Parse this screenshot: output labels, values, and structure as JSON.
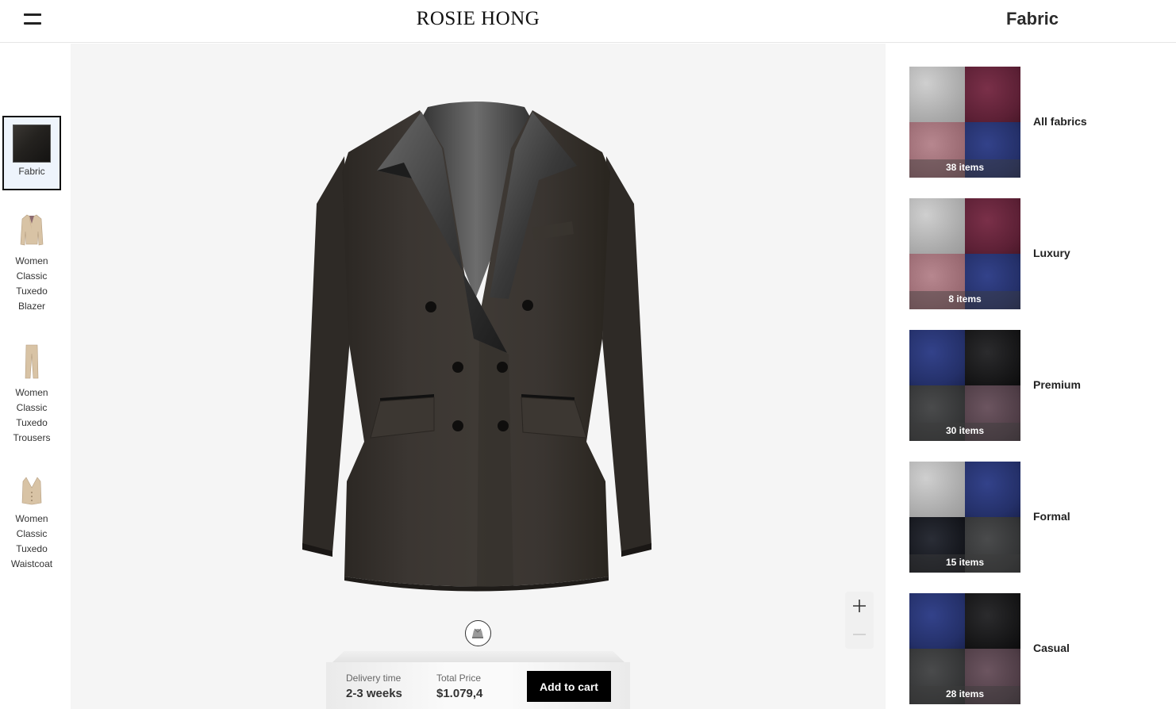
{
  "header": {
    "brand": "ROSIE HONG",
    "panel_title": "Fabric"
  },
  "left_rail": {
    "items": [
      {
        "label": "Fabric",
        "icon": "fabric-swatch-icon",
        "selected": true
      },
      {
        "label": "Women Classic Tuxedo Blazer",
        "icon": "blazer-icon",
        "selected": false
      },
      {
        "label": "Women Classic Tuxedo Trousers",
        "icon": "trousers-icon",
        "selected": false
      },
      {
        "label": "Women Classic Tuxedo Waistcoat",
        "icon": "waistcoat-icon",
        "selected": false
      }
    ]
  },
  "viewer": {
    "product_icon": "double-breasted-tuxedo-blazer",
    "view_toggle_icon": "model-view-icon",
    "zoom_in_icon": "plus-icon",
    "zoom_out_icon": "minus-icon"
  },
  "order_bar": {
    "delivery_label": "Delivery time",
    "delivery_value": "2-3 weeks",
    "price_label": "Total Price",
    "price_value": "$1.079,4",
    "cart_button": "Add to cart"
  },
  "fabric_categories": [
    {
      "name": "All fabrics",
      "count": "38 items",
      "swatches": [
        "grey",
        "burgundy",
        "rose",
        "navy"
      ]
    },
    {
      "name": "Luxury",
      "count": "8 items",
      "swatches": [
        "grey",
        "burgundy",
        "rose",
        "navy"
      ]
    },
    {
      "name": "Premium",
      "count": "30 items",
      "swatches": [
        "navy",
        "black",
        "charcoal",
        "plum"
      ]
    },
    {
      "name": "Formal",
      "count": "15 items",
      "swatches": [
        "grey",
        "navy",
        "blackcheck",
        "charcoal"
      ]
    },
    {
      "name": "Casual",
      "count": "28 items",
      "swatches": [
        "navy",
        "black",
        "charcoal",
        "plum"
      ]
    }
  ],
  "colors": {
    "accent": "#000000",
    "viewer_bg": "#f5f5f5",
    "selected_bg": "#eef4fc"
  }
}
